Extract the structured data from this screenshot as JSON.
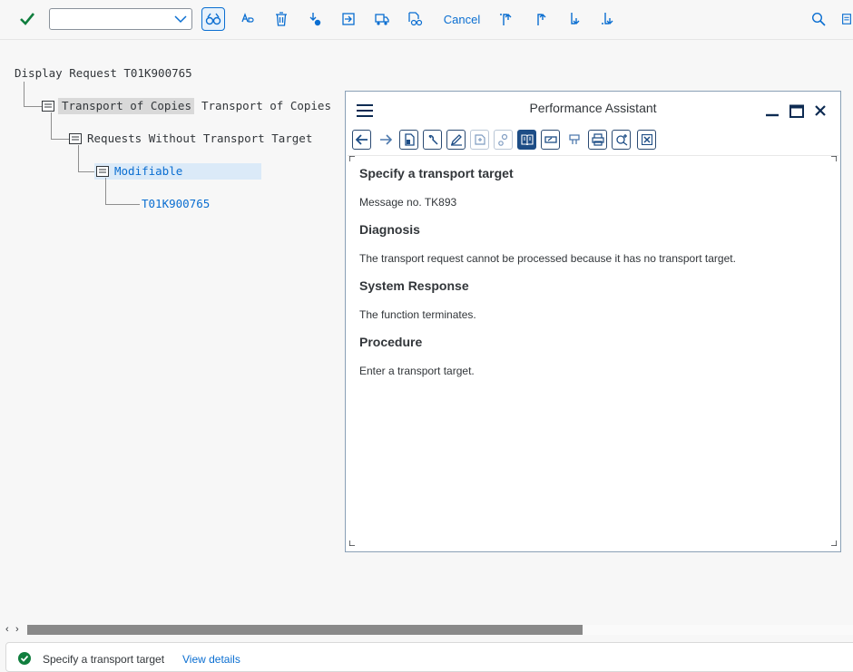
{
  "toolbar": {
    "command_field_value": "",
    "cancel_label": "Cancel",
    "accent": "#0a6ed1",
    "icons": [
      "check-icon",
      "display-glasses-icon",
      "text-edit-icon",
      "delete-icon",
      "release-icon",
      "import-icon",
      "transport-truck-icon",
      "object-list-icon",
      "first-page-icon",
      "previous-page-icon",
      "next-page-icon",
      "last-page-icon",
      "search-icon",
      "more-icon"
    ]
  },
  "tree": {
    "root_label": "Display Request T01K900765",
    "node_copies_label": "Transport of Copies",
    "node_copies_desc": "Transport of Copies",
    "node_requests_label": "Requests Without Transport Target",
    "node_modifiable_label": "Modifiable",
    "node_request_label": "T01K900765"
  },
  "assistant": {
    "title": "Performance Assistant",
    "heading": "Specify a transport target",
    "message_no": "Message no. TK893",
    "diagnosis_title": "Diagnosis",
    "diagnosis_text": "The transport request cannot be processed because it has no transport target.",
    "response_title": "System Response",
    "response_text": "The function terminates.",
    "procedure_title": "Procedure",
    "procedure_text": "Enter a transport target."
  },
  "statusbar": {
    "message": "Specify a transport target",
    "link": "View details",
    "success_color": "#107e3e"
  }
}
